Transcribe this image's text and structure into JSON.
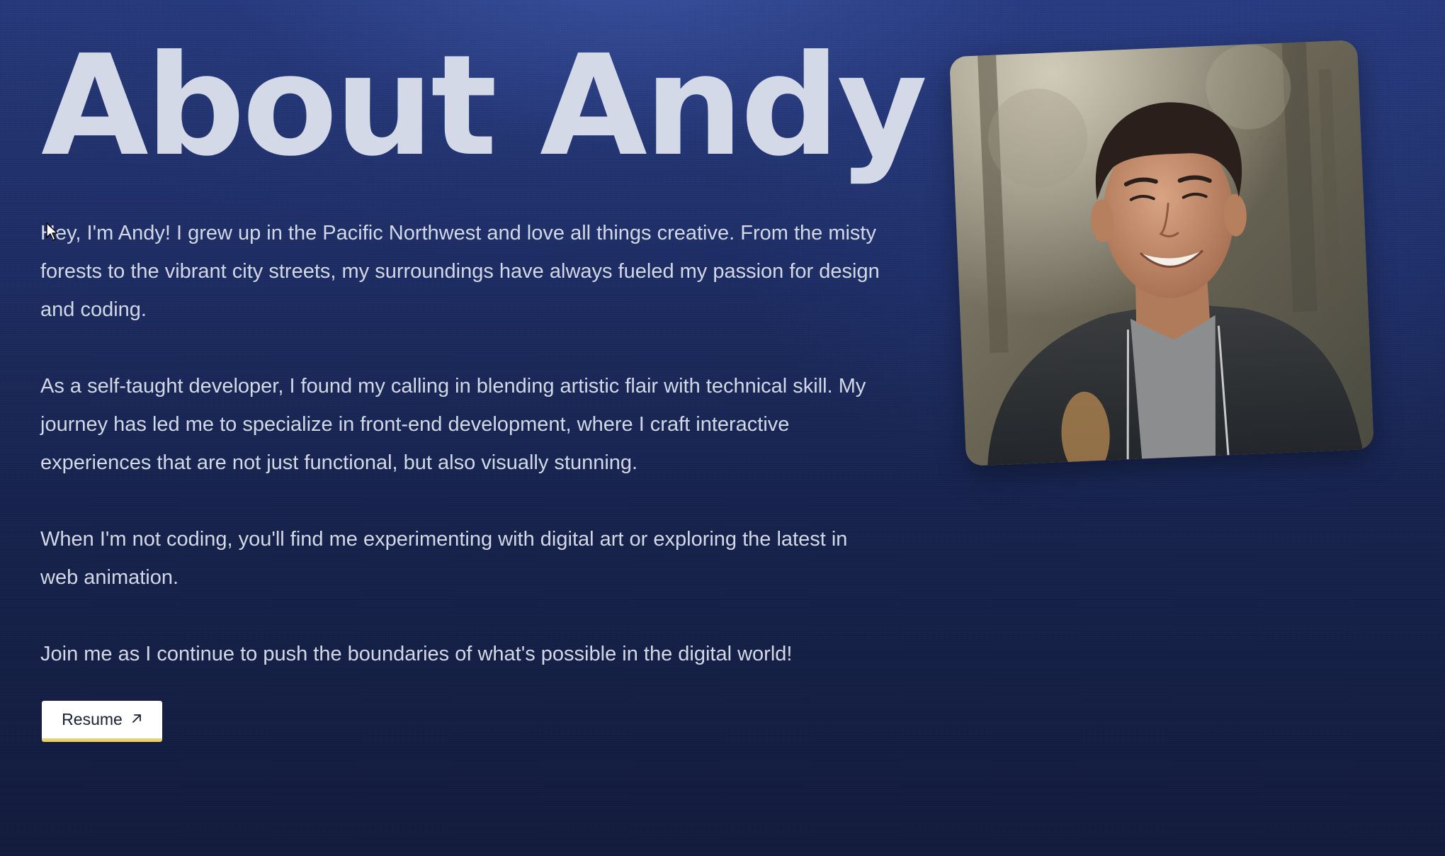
{
  "page": {
    "title": "About Andy"
  },
  "bio": {
    "paragraphs": [
      "Hey, I'm Andy! I grew up in the Pacific Northwest and love all things creative. From the misty forests to the vibrant city streets, my surroundings have always fueled my passion for design and coding.",
      "As a self-taught developer, I found my calling in blending artistic flair with technical skill. My journey has led me to specialize in front-end development, where I craft interactive experiences that are not just functional, but also visually stunning.",
      "When I'm not coding, you'll find me experimenting with digital art or exploring the latest in web animation.",
      "Join me as I continue to push the boundaries of what's possible in the digital world!"
    ]
  },
  "resume": {
    "label": "Resume",
    "icon": "arrow-up-right-icon"
  },
  "photo": {
    "subject": "portrait-photo"
  },
  "colors": {
    "background": "#1d2c63",
    "title": "#d3d9e6",
    "text": "#d2d8e6",
    "button_bg": "#ffffff",
    "button_underline": "#ecd26b"
  }
}
